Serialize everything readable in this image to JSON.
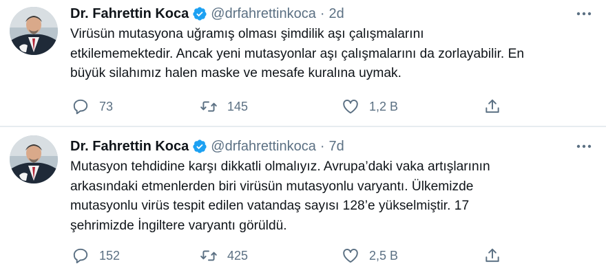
{
  "tweets": [
    {
      "name": "Dr. Fahrettin Koca",
      "handle": "@drfahrettinkoca",
      "separator": "·",
      "time": "2d",
      "lines": [
        "Virüsün mutasyona uğramış olması şimdilik aşı çalışmalarını",
        "etkilememektedir. Ancak yeni mutasyonlar aşı çalışmalarını da zorlayabilir. En",
        "büyük silahımız halen maske ve mesafe kuralına uymak."
      ],
      "replies": "73",
      "retweets": "145",
      "likes": "1,2 B"
    },
    {
      "name": "Dr. Fahrettin Koca",
      "handle": "@drfahrettinkoca",
      "separator": "·",
      "time": "7d",
      "lines": [
        "Mutasyon tehdidine karşı dikkatli olmalıyız. Avrupa’daki vaka artışlarının",
        "arkasındaki etmenlerden biri virüsün mutasyonlu varyantı. Ülkemizde",
        "mutasyonlu virüs tespit edilen vatandaş sayısı 128’e yükselmiştir. 17",
        "şehrimizde İngiltere varyantı görüldü."
      ],
      "replies": "152",
      "retweets": "425",
      "likes": "2,5 B"
    }
  ],
  "colors": {
    "text": "#0f1419",
    "secondary": "#5b7083",
    "verified": "#1da1f2",
    "divider": "#e6ecf0"
  },
  "icons": [
    "verified-badge-icon",
    "more-options-icon",
    "reply-icon",
    "retweet-icon",
    "like-icon",
    "share-icon"
  ]
}
